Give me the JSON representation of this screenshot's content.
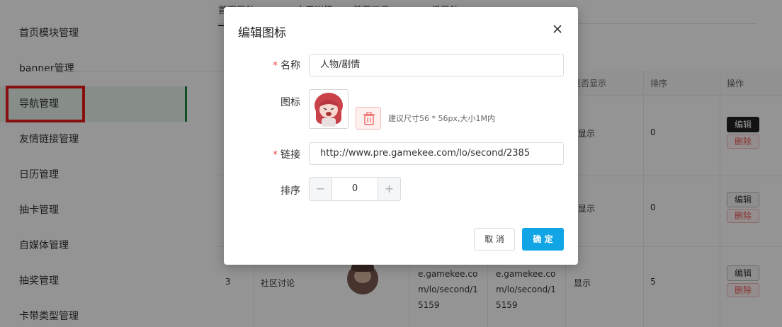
{
  "sidebar": {
    "items": [
      {
        "label": "首页模块管理"
      },
      {
        "label": "banner管理"
      },
      {
        "label": "导航管理"
      },
      {
        "label": "友情链接管理"
      },
      {
        "label": "日历管理"
      },
      {
        "label": "抽卡管理"
      },
      {
        "label": "自媒体管理"
      },
      {
        "label": "抽奖管理"
      },
      {
        "label": "卡带类型管理"
      }
    ],
    "active_index": 2
  },
  "main": {
    "tabs": [
      {
        "label": "首页导航"
      },
      {
        "label": "文章详情"
      },
      {
        "label": "首页工具"
      },
      {
        "label": "二级导航"
      }
    ],
    "table": {
      "headers": [
        "是否显示",
        "排序",
        "操作"
      ],
      "rows": [
        {
          "show": "显示",
          "sort": "0",
          "edit": "编辑",
          "delete": "删除"
        },
        {
          "show": "显示",
          "sort": "0",
          "edit": "编辑",
          "delete": "删除"
        },
        {
          "index": "3",
          "name": "社区讨论",
          "link1_l1": "e.gamekee.co",
          "link1_l2": "m/lo/second/1",
          "link1_l3": "5159",
          "link2_l1": "e.gamekee.co",
          "link2_l2": "m/lo/second/1",
          "link2_l3": "5159",
          "show": "显示",
          "sort": "5",
          "edit": "编辑",
          "delete": "删除"
        }
      ]
    }
  },
  "modal": {
    "title": "编辑图标",
    "required_mark": "*",
    "name_label": "名称",
    "name_value": "人物/剧情",
    "icon_label": "图标",
    "icon_hint": "建议尺寸56 * 56px,大小1M内",
    "link_label": "链接",
    "link_value": "http://www.pre.gamekee.com/lo/second/2385",
    "sort_label": "排序",
    "sort_value": "0",
    "minus": "−",
    "plus": "+",
    "cancel": "取 消",
    "confirm": "确 定"
  },
  "colors": {
    "accent": "#12a5e6",
    "sidebar_active": "#1b8a44",
    "highlight": "#e81b1b",
    "required": "#e84444"
  }
}
